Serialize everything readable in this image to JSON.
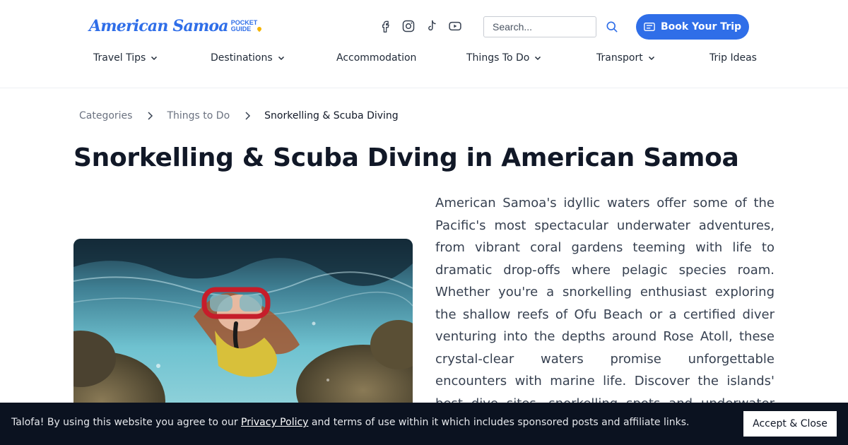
{
  "header": {
    "logo_text": "American Samoa",
    "logo_badge": [
      "POCKET",
      "GUIDE"
    ],
    "socials": [
      "facebook-icon",
      "instagram-icon",
      "tiktok-icon",
      "youtube-icon"
    ],
    "search_placeholder": "Search...",
    "book_button": "Book Your Trip",
    "accent": "#2f6ee8"
  },
  "nav": {
    "items": [
      {
        "label": "Travel Tips",
        "dropdown": true
      },
      {
        "label": "Destinations",
        "dropdown": true
      },
      {
        "label": "Accommodation",
        "dropdown": false
      },
      {
        "label": "Things To Do",
        "dropdown": true
      },
      {
        "label": "Transport",
        "dropdown": true
      },
      {
        "label": "Trip Ideas",
        "dropdown": false
      }
    ]
  },
  "breadcrumb": {
    "items": [
      "Categories",
      "Things to Do",
      "Snorkelling & Scuba Diving"
    ]
  },
  "page": {
    "title": "Snorkelling & Scuba Diving in American Samoa",
    "intro": "American Samoa's idyllic waters offer some of the Pacific's most spectacular underwater adventures, from vibrant coral gardens teeming with life to dramatic drop-offs where pelagic species roam. Whether you're a snorkelling enthusiast exploring the shallow reefs of Ofu Beach or a certified diver venturing into the depths around Rose Atoll, these crystal-clear waters promise unforgettable encounters with marine life. Discover the islands' best dive sites, snorkelling spots and underwater experiences with our comprehensive guides, compiled by"
  },
  "cookie": {
    "text_before": "Talofa! By using this website you agree to our ",
    "link": "Privacy Policy",
    "text_after": " and terms of use within it which includes sponsored posts and affiliate links.",
    "button": "Accept & Close"
  }
}
